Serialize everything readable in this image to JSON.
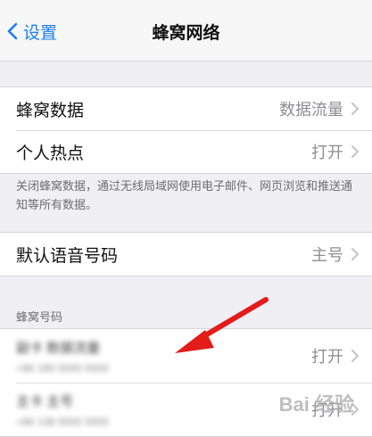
{
  "nav": {
    "back_label": "设置",
    "title": "蜂窝网络"
  },
  "group1": {
    "cellular_data_label": "蜂窝数据",
    "cellular_data_value": "数据流量",
    "hotspot_label": "个人热点",
    "hotspot_value": "打开"
  },
  "footer_text": "关闭蜂窝数据，通过无线局域网使用电子邮件、网页浏览和推送通知等所有数据。",
  "group2": {
    "voice_label": "默认语音号码",
    "voice_value": "主号"
  },
  "cellular_numbers": {
    "header": "蜂窝号码",
    "items": [
      {
        "name": "副卡 数据流量",
        "number": "+86 180 0000 0000",
        "value": "打开"
      },
      {
        "name": "主卡 主号",
        "number": "+86 138 0000 0000",
        "value": "打开"
      }
    ]
  },
  "colors": {
    "accent": "#1a7ef2",
    "annotation_arrow": "#e31b1b"
  },
  "watermark": "Bai 经验"
}
